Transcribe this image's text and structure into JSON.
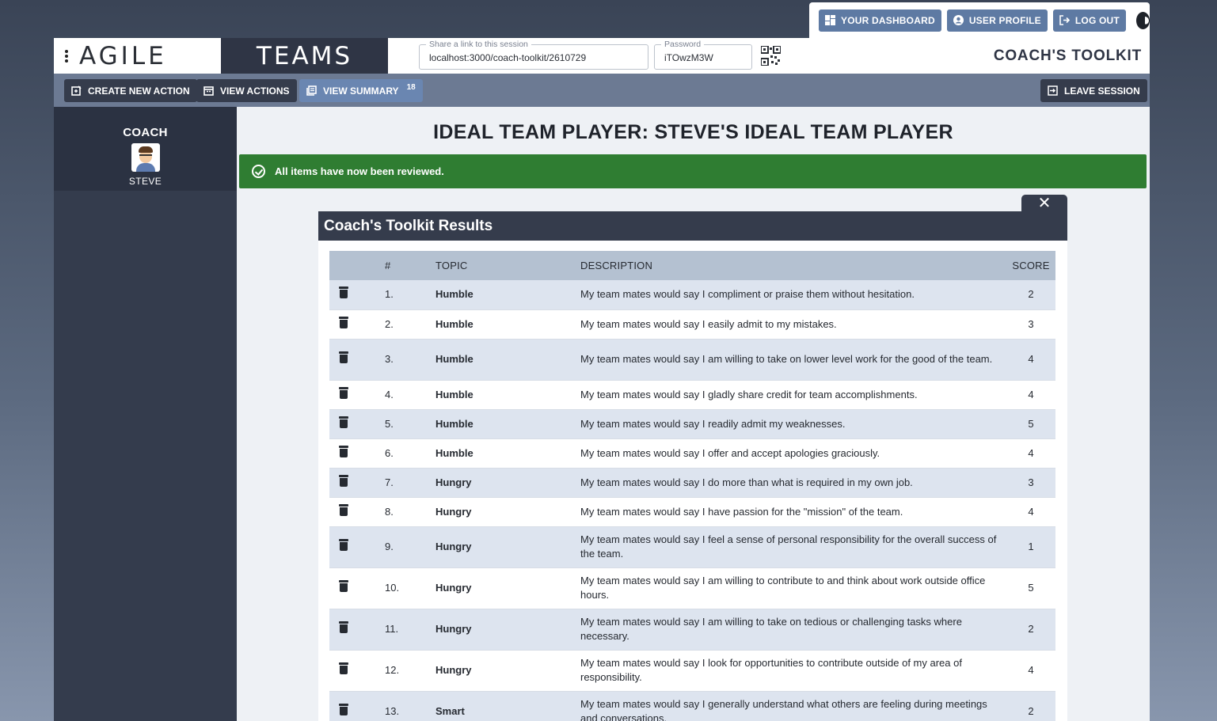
{
  "topnav": {
    "dashboard": "YOUR DASHBOARD",
    "profile": "USER PROFILE",
    "logout": "LOG OUT"
  },
  "header": {
    "logo_left": "AGILE",
    "logo_right": "TEAMS",
    "share_label": "Share a link to this session",
    "share_value": "localhost:3000/coach-toolkit/2610729",
    "password_label": "Password",
    "password_value": "iTOwzM3W",
    "title": "COACH'S TOOLKIT"
  },
  "actions": {
    "create": "CREATE NEW ACTION",
    "view_actions": "VIEW ACTIONS",
    "view_summary": "VIEW SUMMARY",
    "summary_count": "18",
    "leave": "LEAVE SESSION"
  },
  "sidebar": {
    "role": "COACH",
    "name": "STEVE"
  },
  "main": {
    "title": "IDEAL TEAM PLAYER: STEVE'S IDEAL TEAM PLAYER",
    "alert": "All items have now been reviewed.",
    "close_symbol": "✕"
  },
  "modal": {
    "title": "Coach's Toolkit Results",
    "columns": [
      "#",
      "TOPIC",
      "DESCRIPTION",
      "SCORE"
    ],
    "rows": [
      {
        "num": "1.",
        "topic": "Humble",
        "desc": "My team mates would say I compliment or praise them without hesitation.",
        "score": "2"
      },
      {
        "num": "2.",
        "topic": "Humble",
        "desc": "My team mates would say I easily admit to my mistakes.",
        "score": "3"
      },
      {
        "num": "3.",
        "topic": "Humble",
        "desc": "My team mates would say I am willing to take on lower level work for the good of the team.",
        "score": "4"
      },
      {
        "num": "4.",
        "topic": "Humble",
        "desc": "My team mates would say I gladly share credit for team accomplishments.",
        "score": "4"
      },
      {
        "num": "5.",
        "topic": "Humble",
        "desc": "My team mates would say I readily admit my weaknesses.",
        "score": "5"
      },
      {
        "num": "6.",
        "topic": "Humble",
        "desc": "My team mates would say I offer and accept apologies graciously.",
        "score": "4"
      },
      {
        "num": "7.",
        "topic": "Hungry",
        "desc": "My team mates would say I do more than what is required in my own job.",
        "score": "3"
      },
      {
        "num": "8.",
        "topic": "Hungry",
        "desc": "My team mates would say I have passion for the \"mission\" of the team.",
        "score": "4"
      },
      {
        "num": "9.",
        "topic": "Hungry",
        "desc": "My team mates would say I feel a sense of personal responsibility for the overall success of the team.",
        "score": "1"
      },
      {
        "num": "10.",
        "topic": "Hungry",
        "desc": "My team mates would say I am willing to contribute to and think about work outside office hours.",
        "score": "5"
      },
      {
        "num": "11.",
        "topic": "Hungry",
        "desc": "My team mates would say I am willing to take on tedious or challenging tasks where necessary.",
        "score": "2"
      },
      {
        "num": "12.",
        "topic": "Hungry",
        "desc": "My team mates would say I look for opportunities to contribute outside of my area of responsibility.",
        "score": "4"
      },
      {
        "num": "13.",
        "topic": "Smart",
        "desc": "My team mates would say I generally understand what others are feeling during meetings and conversations.",
        "score": "2"
      }
    ]
  }
}
